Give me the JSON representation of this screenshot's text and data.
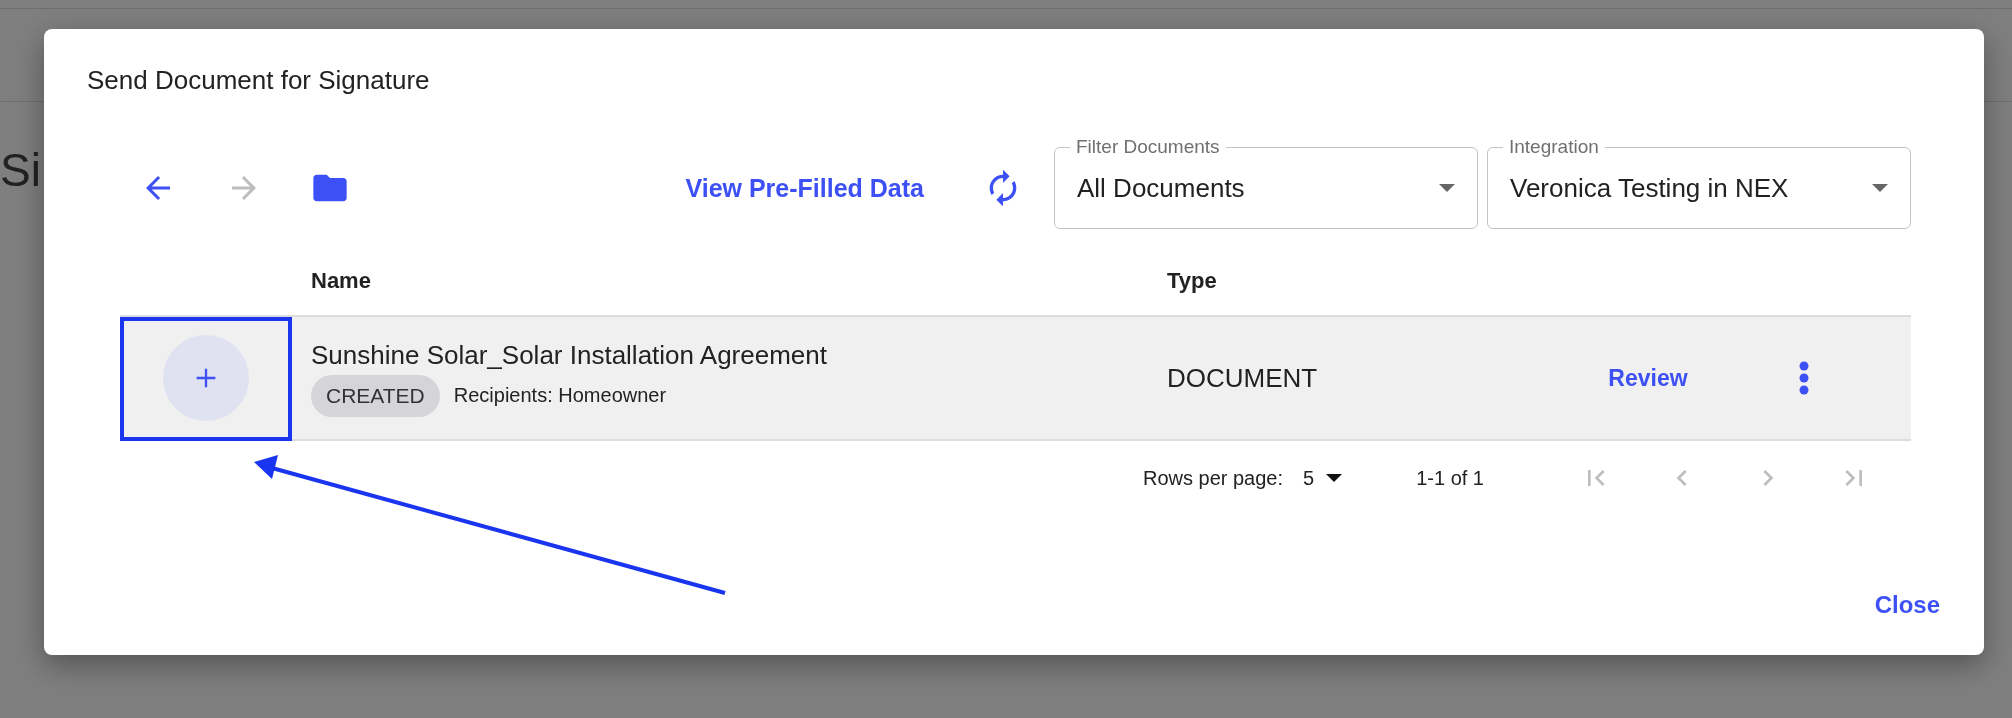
{
  "background": {
    "heading": "Si"
  },
  "dialog": {
    "title": "Send Document for Signature",
    "nav": [
      {
        "kind": "back",
        "disabled": false
      },
      {
        "kind": "forward",
        "disabled": true
      }
    ],
    "prefill_link": "View Pre-Filled Data",
    "filters": [
      {
        "label": "Filter Documents",
        "value": "All Documents"
      },
      {
        "label": "Integration",
        "value": "Veronica Testing in NEX"
      }
    ],
    "table": {
      "columns": [
        "Name",
        "Type"
      ],
      "rows": [
        {
          "name": "Sunshine Solar_Solar Installation Agreement",
          "status": "CREATED",
          "recipients": "Recipients: Homeowner",
          "type": "DOCUMENT",
          "action": "Review"
        }
      ]
    },
    "pagination": {
      "rows_per_page_label": "Rows per page:",
      "rows_per_page": "5",
      "range": "1-1 of 1",
      "buttons": [
        {
          "kind": "first",
          "disabled": true
        },
        {
          "kind": "previous",
          "disabled": true
        },
        {
          "kind": "next",
          "disabled": true
        },
        {
          "kind": "last",
          "disabled": true
        }
      ]
    },
    "close": "Close"
  }
}
